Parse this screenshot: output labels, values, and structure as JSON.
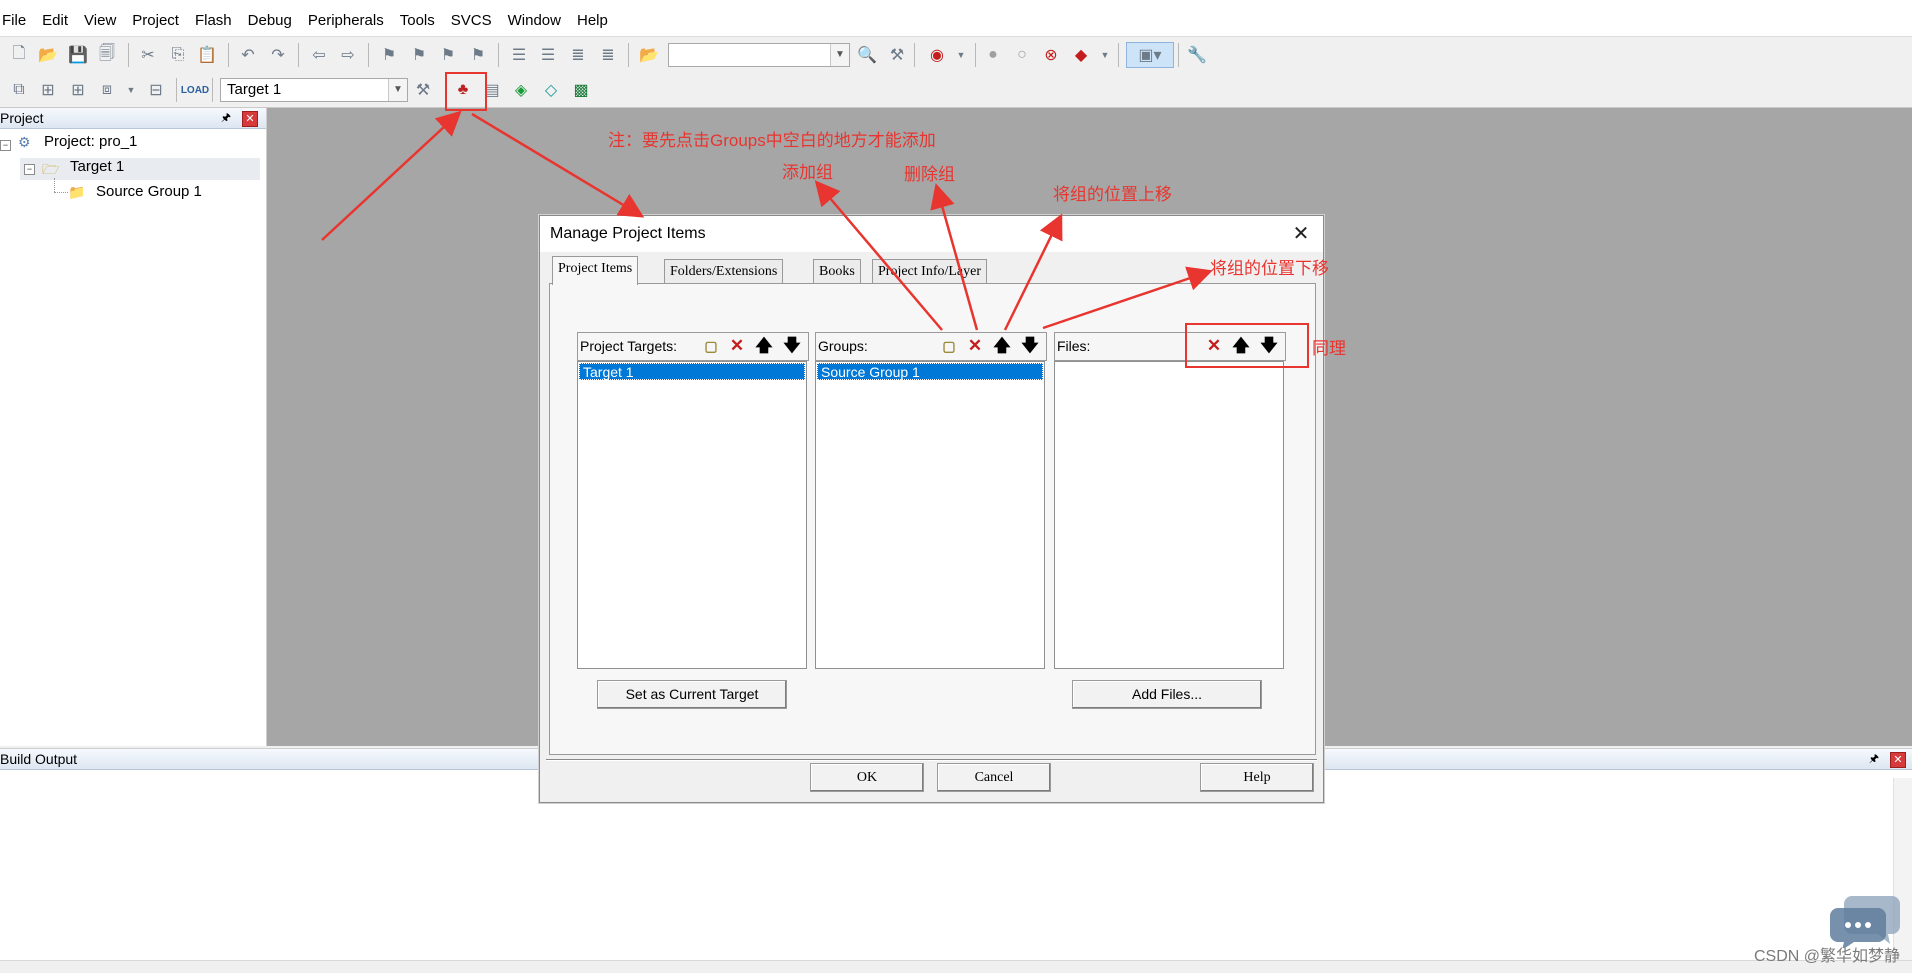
{
  "menu": [
    "File",
    "Edit",
    "View",
    "Project",
    "Flash",
    "Debug",
    "Peripherals",
    "Tools",
    "SVCS",
    "Window",
    "Help"
  ],
  "toolbar": {
    "target_combo": "Target 1"
  },
  "project_pane": {
    "title": "Project",
    "tree": [
      {
        "label": "Project: pro_1"
      },
      {
        "label": "Target 1"
      },
      {
        "label": "Source Group 1"
      }
    ]
  },
  "build_output": {
    "title": "Build Output"
  },
  "dialog": {
    "title": "Manage Project Items",
    "tabs": [
      "Project Items",
      "Folders/Extensions",
      "Books",
      "Project Info/Layer"
    ],
    "columns": {
      "targets": {
        "label": "Project Targets:",
        "items": [
          "Target 1"
        ]
      },
      "groups": {
        "label": "Groups:",
        "items": [
          "Source Group 1"
        ]
      },
      "files": {
        "label": "Files:",
        "items": []
      }
    },
    "buttons": {
      "set_current": "Set as Current Target",
      "add_files": "Add Files...",
      "ok": "OK",
      "cancel": "Cancel",
      "help": "Help"
    }
  },
  "annotations": {
    "note": "注：要先点击Groups中空白的地方才能添加",
    "add_group": "添加组",
    "delete_group": "删除组",
    "move_up": "将组的位置上移",
    "move_down": "将组的位置下移",
    "same": "同理"
  },
  "watermark": "CSDN @繁华如梦静",
  "colors": {
    "annotation": "#e8352f",
    "selection": "#0078d7",
    "workspace": "#a6a6a6"
  }
}
